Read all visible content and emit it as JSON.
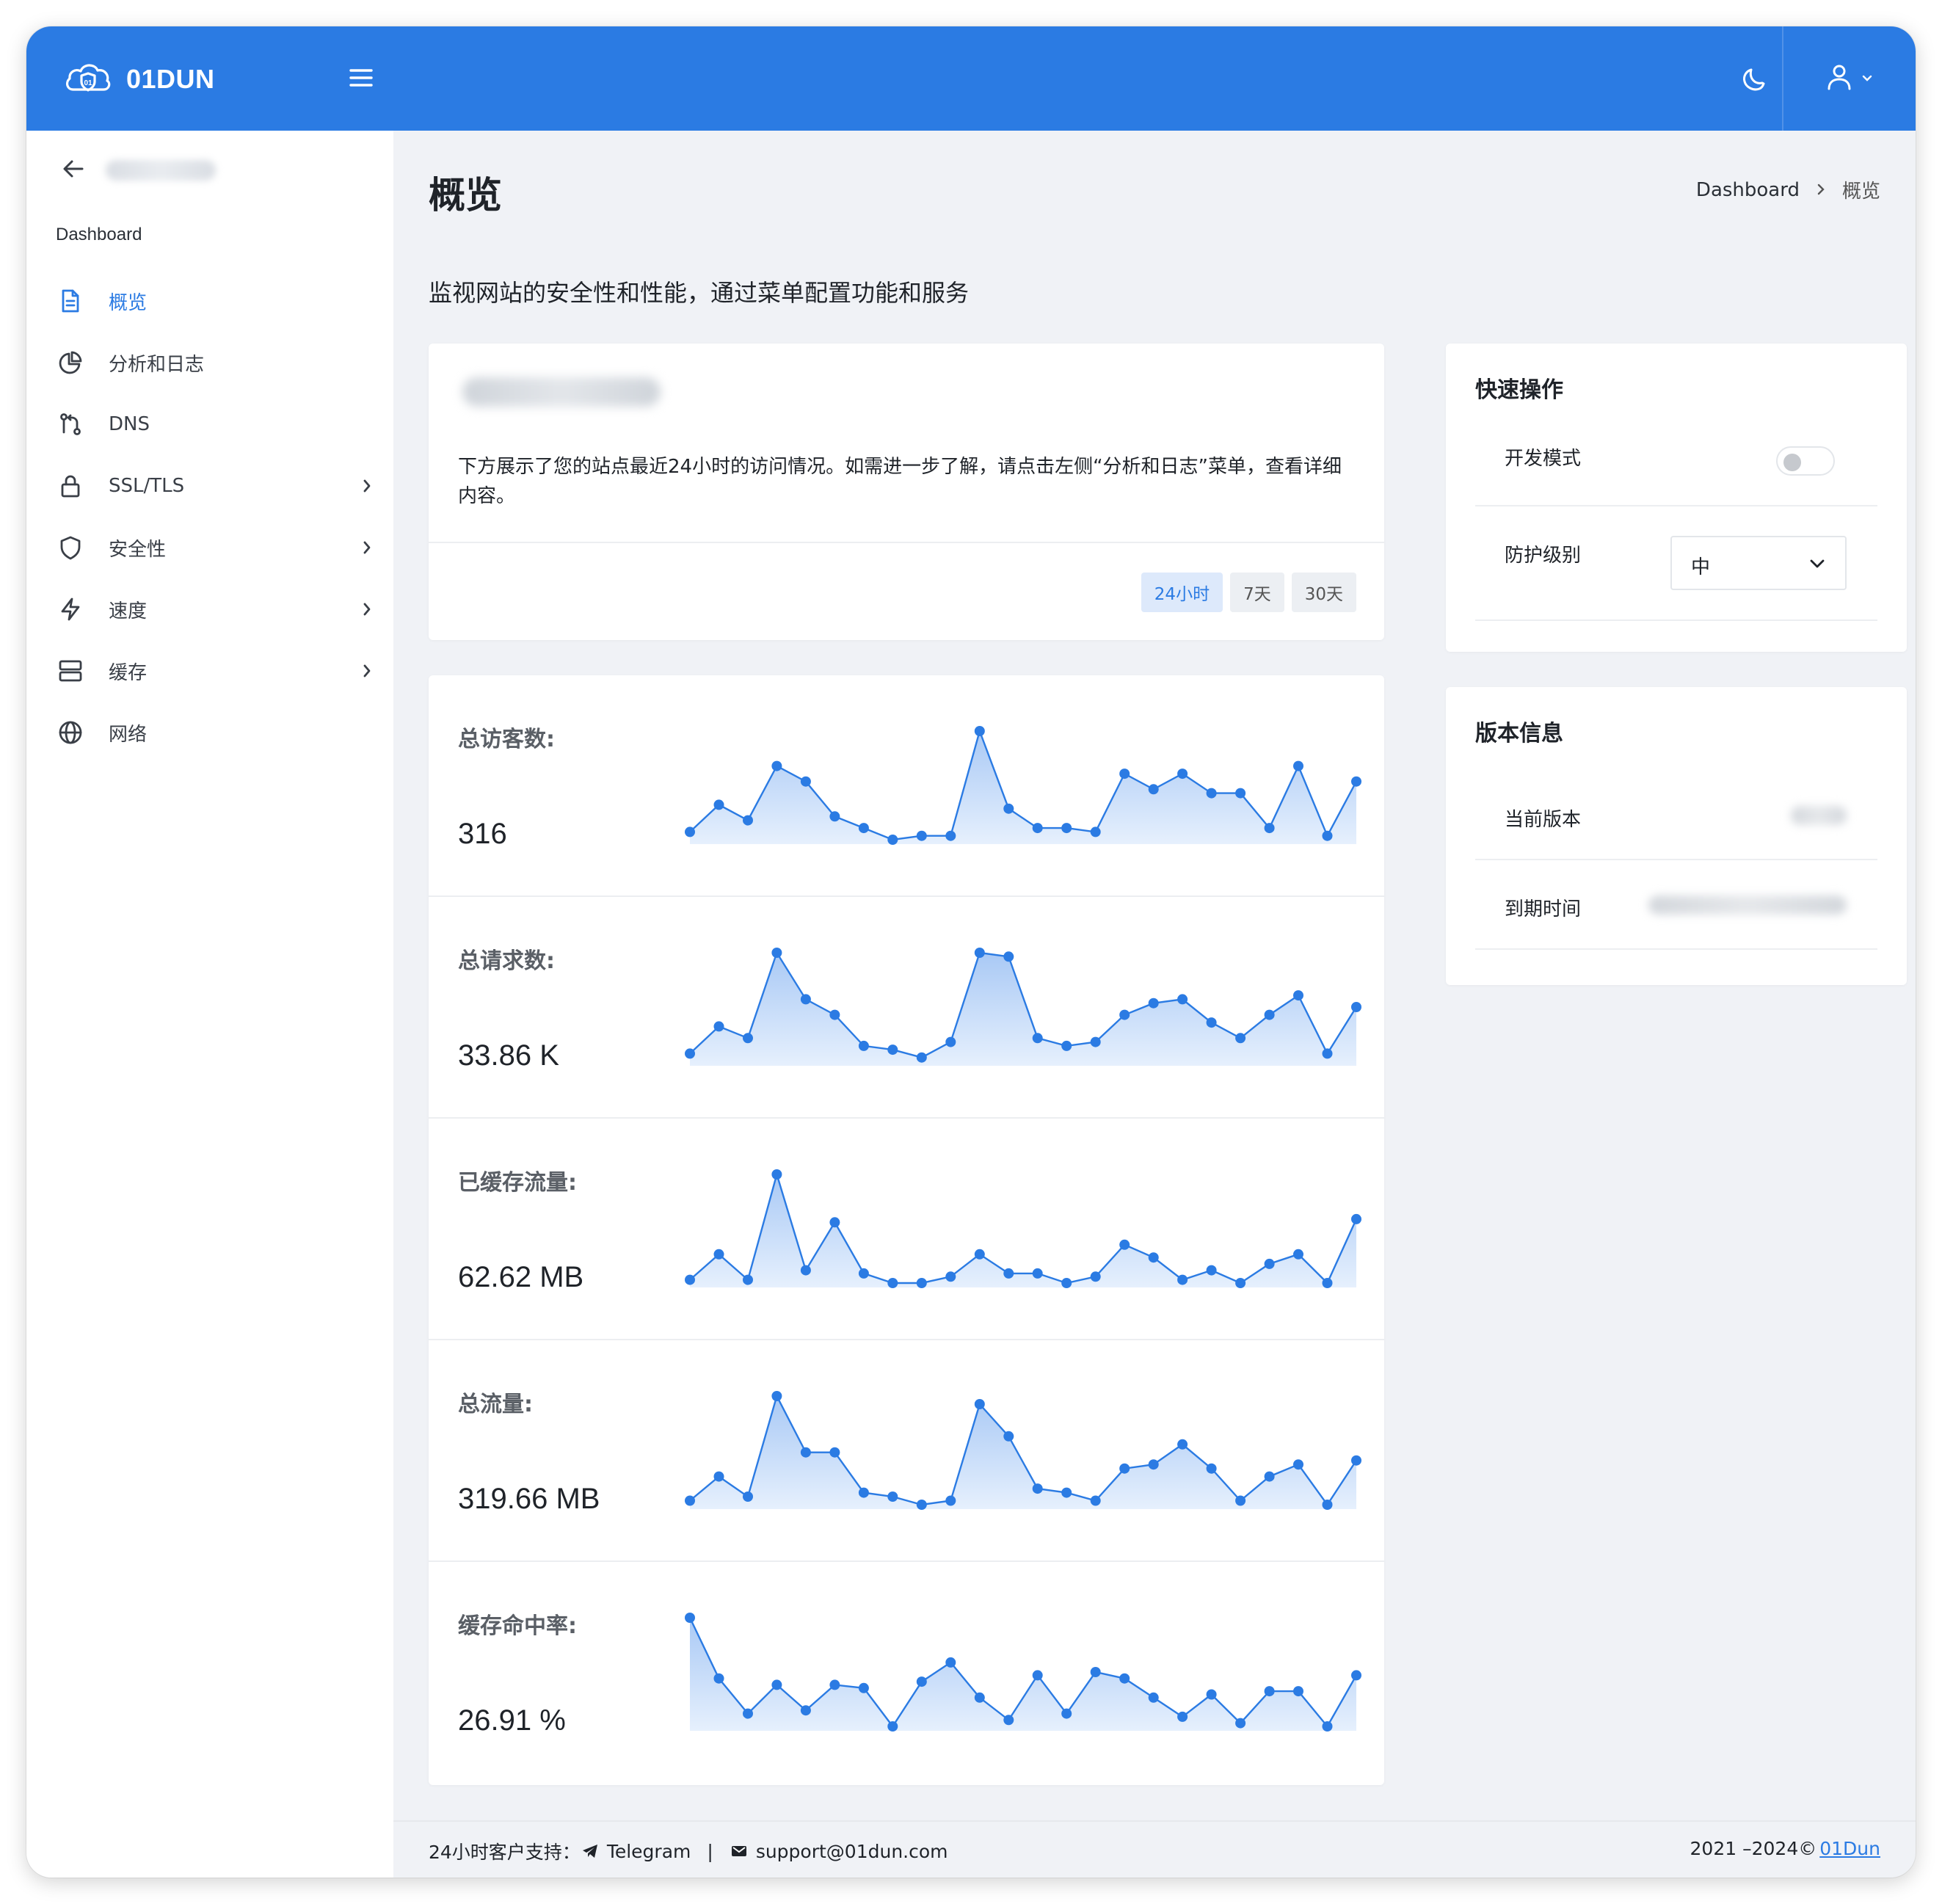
{
  "app": {
    "name": "01DUN"
  },
  "sidebar": {
    "heading": "Dashboard",
    "items": [
      {
        "label": "概览",
        "icon": "document-icon",
        "active": true,
        "has_submenu": false
      },
      {
        "label": "分析和日志",
        "icon": "pie-chart-icon",
        "active": false,
        "has_submenu": false
      },
      {
        "label": "DNS",
        "icon": "route-icon",
        "active": false,
        "has_submenu": false
      },
      {
        "label": "SSL/TLS",
        "icon": "lock-icon",
        "active": false,
        "has_submenu": true
      },
      {
        "label": "安全性",
        "icon": "shield-icon",
        "active": false,
        "has_submenu": true
      },
      {
        "label": "速度",
        "icon": "lightning-icon",
        "active": false,
        "has_submenu": true
      },
      {
        "label": "缓存",
        "icon": "server-icon",
        "active": false,
        "has_submenu": true
      },
      {
        "label": "网络",
        "icon": "globe-icon",
        "active": false,
        "has_submenu": false
      }
    ]
  },
  "page": {
    "title": "概览",
    "subtitle": "监视网站的安全性和性能，通过菜单配置功能和服务",
    "breadcrumb": {
      "root": "Dashboard",
      "current": "概览"
    }
  },
  "site_card": {
    "description": "下方展示了您的站点最近24小时的访问情况。如需进一步了解，请点击左侧“分析和日志”菜单，查看详细内容。",
    "ranges": [
      "24小时",
      "7天",
      "30天"
    ],
    "active_range": "24小时"
  },
  "stats": [
    {
      "label": "总访客数:",
      "value": "316",
      "series": [
        2,
        9,
        5,
        19,
        15,
        6,
        3,
        0,
        1,
        1,
        28,
        8,
        3,
        3,
        2,
        17,
        13,
        17,
        12,
        12,
        3,
        19,
        1,
        15
      ]
    },
    {
      "label": "总请求数:",
      "value": "33.86 K",
      "series": [
        2,
        9,
        6,
        28,
        16,
        12,
        4,
        3,
        1,
        5,
        28,
        27,
        6,
        4,
        5,
        12,
        15,
        16,
        10,
        6,
        12,
        17,
        2,
        14
      ]
    },
    {
      "label": "已缓存流量:",
      "value": "62.62 MB",
      "series": [
        1,
        9,
        1,
        34,
        4,
        19,
        3,
        0,
        0,
        2,
        9,
        3,
        3,
        0,
        2,
        12,
        8,
        1,
        4,
        0,
        6,
        9,
        0,
        20
      ]
    },
    {
      "label": "总流量:",
      "value": "319.66 MB",
      "series": [
        1,
        7,
        2,
        27,
        13,
        13,
        3,
        2,
        0,
        1,
        25,
        17,
        4,
        3,
        1,
        9,
        10,
        15,
        9,
        1,
        7,
        10,
        0,
        11
      ]
    },
    {
      "label": "缓存命中率:",
      "value": "26.91 %",
      "series": [
        34,
        15,
        4,
        13,
        5,
        13,
        12,
        0,
        14,
        20,
        9,
        2,
        16,
        4,
        17,
        15,
        9,
        3,
        10,
        1,
        11,
        11,
        0,
        16
      ]
    }
  ],
  "quick_actions": {
    "title": "快速操作",
    "dev_mode_label": "开发模式",
    "dev_mode_on": false,
    "protection_label": "防护级别",
    "protection_value": "中"
  },
  "version_info": {
    "title": "版本信息",
    "current_version_label": "当前版本",
    "expiry_label": "到期时间"
  },
  "footer": {
    "support_label": "24小时客户支持：",
    "telegram": "Telegram",
    "separator": "|",
    "email": "support@01dun.com",
    "copyright": "2021 –2024©",
    "brand_link": "01Dun"
  },
  "colors": {
    "primary": "#2b7be3",
    "chart_line": "#2b7be3",
    "chart_fill_top": "#a9c9f5",
    "chart_fill_bottom": "#e6f0fd"
  }
}
